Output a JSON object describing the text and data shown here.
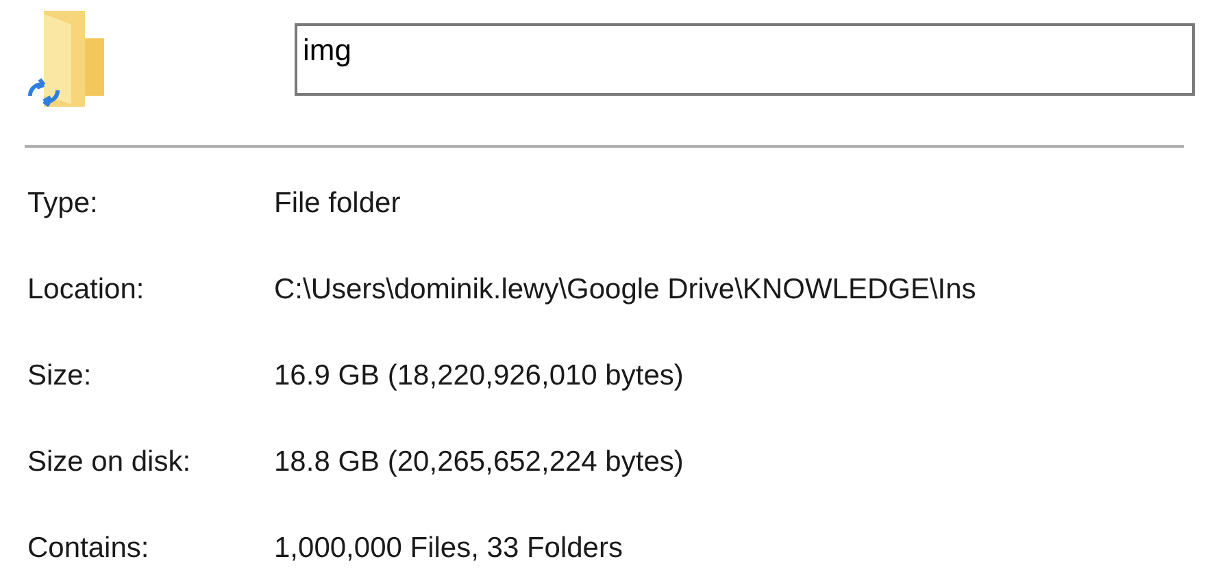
{
  "name_field": {
    "value": "img"
  },
  "properties": [
    {
      "label": "Type:",
      "value": "File folder"
    },
    {
      "label": "Location:",
      "value": "C:\\Users\\dominik.lewy\\Google Drive\\KNOWLEDGE\\Ins"
    },
    {
      "label": "Size:",
      "value": "16.9 GB (18,220,926,010 bytes)"
    },
    {
      "label": "Size on disk:",
      "value": "18.8 GB (20,265,652,224 bytes)"
    },
    {
      "label": "Contains:",
      "value": "1,000,000 Files, 33 Folders"
    }
  ]
}
